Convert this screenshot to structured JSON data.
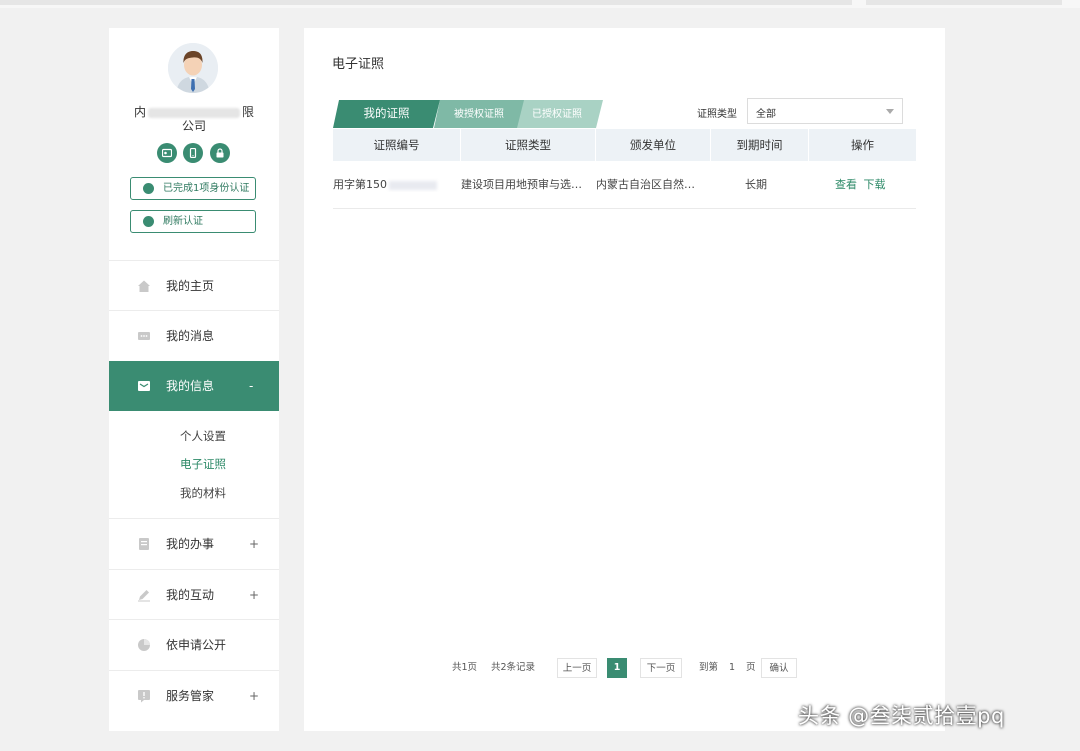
{
  "sidebar": {
    "company_left": "内",
    "company_right": "限",
    "company_line2": "公司",
    "auth_done": "已完成1项身份认证",
    "auth_refresh": "刷新认证",
    "nav": [
      {
        "label": "我的主页",
        "toggle": ""
      },
      {
        "label": "我的消息",
        "toggle": ""
      },
      {
        "label": "我的信息",
        "toggle": "-"
      },
      {
        "label": "我的办事",
        "toggle": "+"
      },
      {
        "label": "我的互动",
        "toggle": "+"
      },
      {
        "label": "依申请公开",
        "toggle": ""
      },
      {
        "label": "服务管家",
        "toggle": "+"
      }
    ],
    "sub": [
      "个人设置",
      "电子证照",
      "我的材料"
    ]
  },
  "main": {
    "title": "电子证照",
    "tabs": [
      "我的证照",
      "被授权证照",
      "已授权证照"
    ],
    "type_label": "证照类型",
    "type_value": "全部",
    "columns": [
      "证照编号",
      "证照类型",
      "颁发单位",
      "到期时间",
      "操作"
    ],
    "rows": [
      {
        "number_prefix": "用字第150",
        "type": "建设项目用地预审与选…",
        "issuer": "内蒙古自治区自然…",
        "expiry": "长期",
        "view": "查看",
        "download": "下载"
      }
    ]
  },
  "pager": {
    "pages_total": "共1页",
    "records_total": "共2条记录",
    "prev": "上一页",
    "current": "1",
    "next": "下一页",
    "goto_prefix": "到第",
    "goto_value": "1",
    "goto_suffix": "页",
    "confirm": "确认"
  },
  "watermark": "头条 @叁柒贰拾壹pq",
  "colors": {
    "accent": "#3a8c72",
    "link": "#2e8a68"
  }
}
